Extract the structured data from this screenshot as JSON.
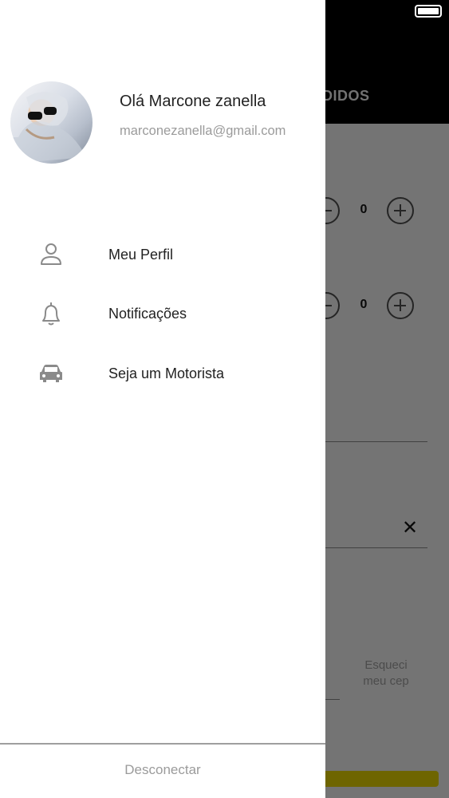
{
  "status_bar": {
    "battery_icon": "battery-full-icon"
  },
  "background": {
    "tab_label": "DIDOS",
    "stepper_1_value": "0",
    "stepper_2_value": "0",
    "clear_icon": "close-icon",
    "forgot_cep": "Esqueci meu cep"
  },
  "drawer": {
    "avatar_icon": "user-photo",
    "greeting": "Olá Marcone zanella",
    "email": "marconezanella@gmail.com",
    "menu": [
      {
        "label": "Meu Perfil",
        "icon": "person-icon"
      },
      {
        "label": "Notificações",
        "icon": "bell-icon"
      },
      {
        "label": "Seja um Motorista",
        "icon": "car-icon"
      }
    ],
    "logout_label": "Desconectar"
  }
}
